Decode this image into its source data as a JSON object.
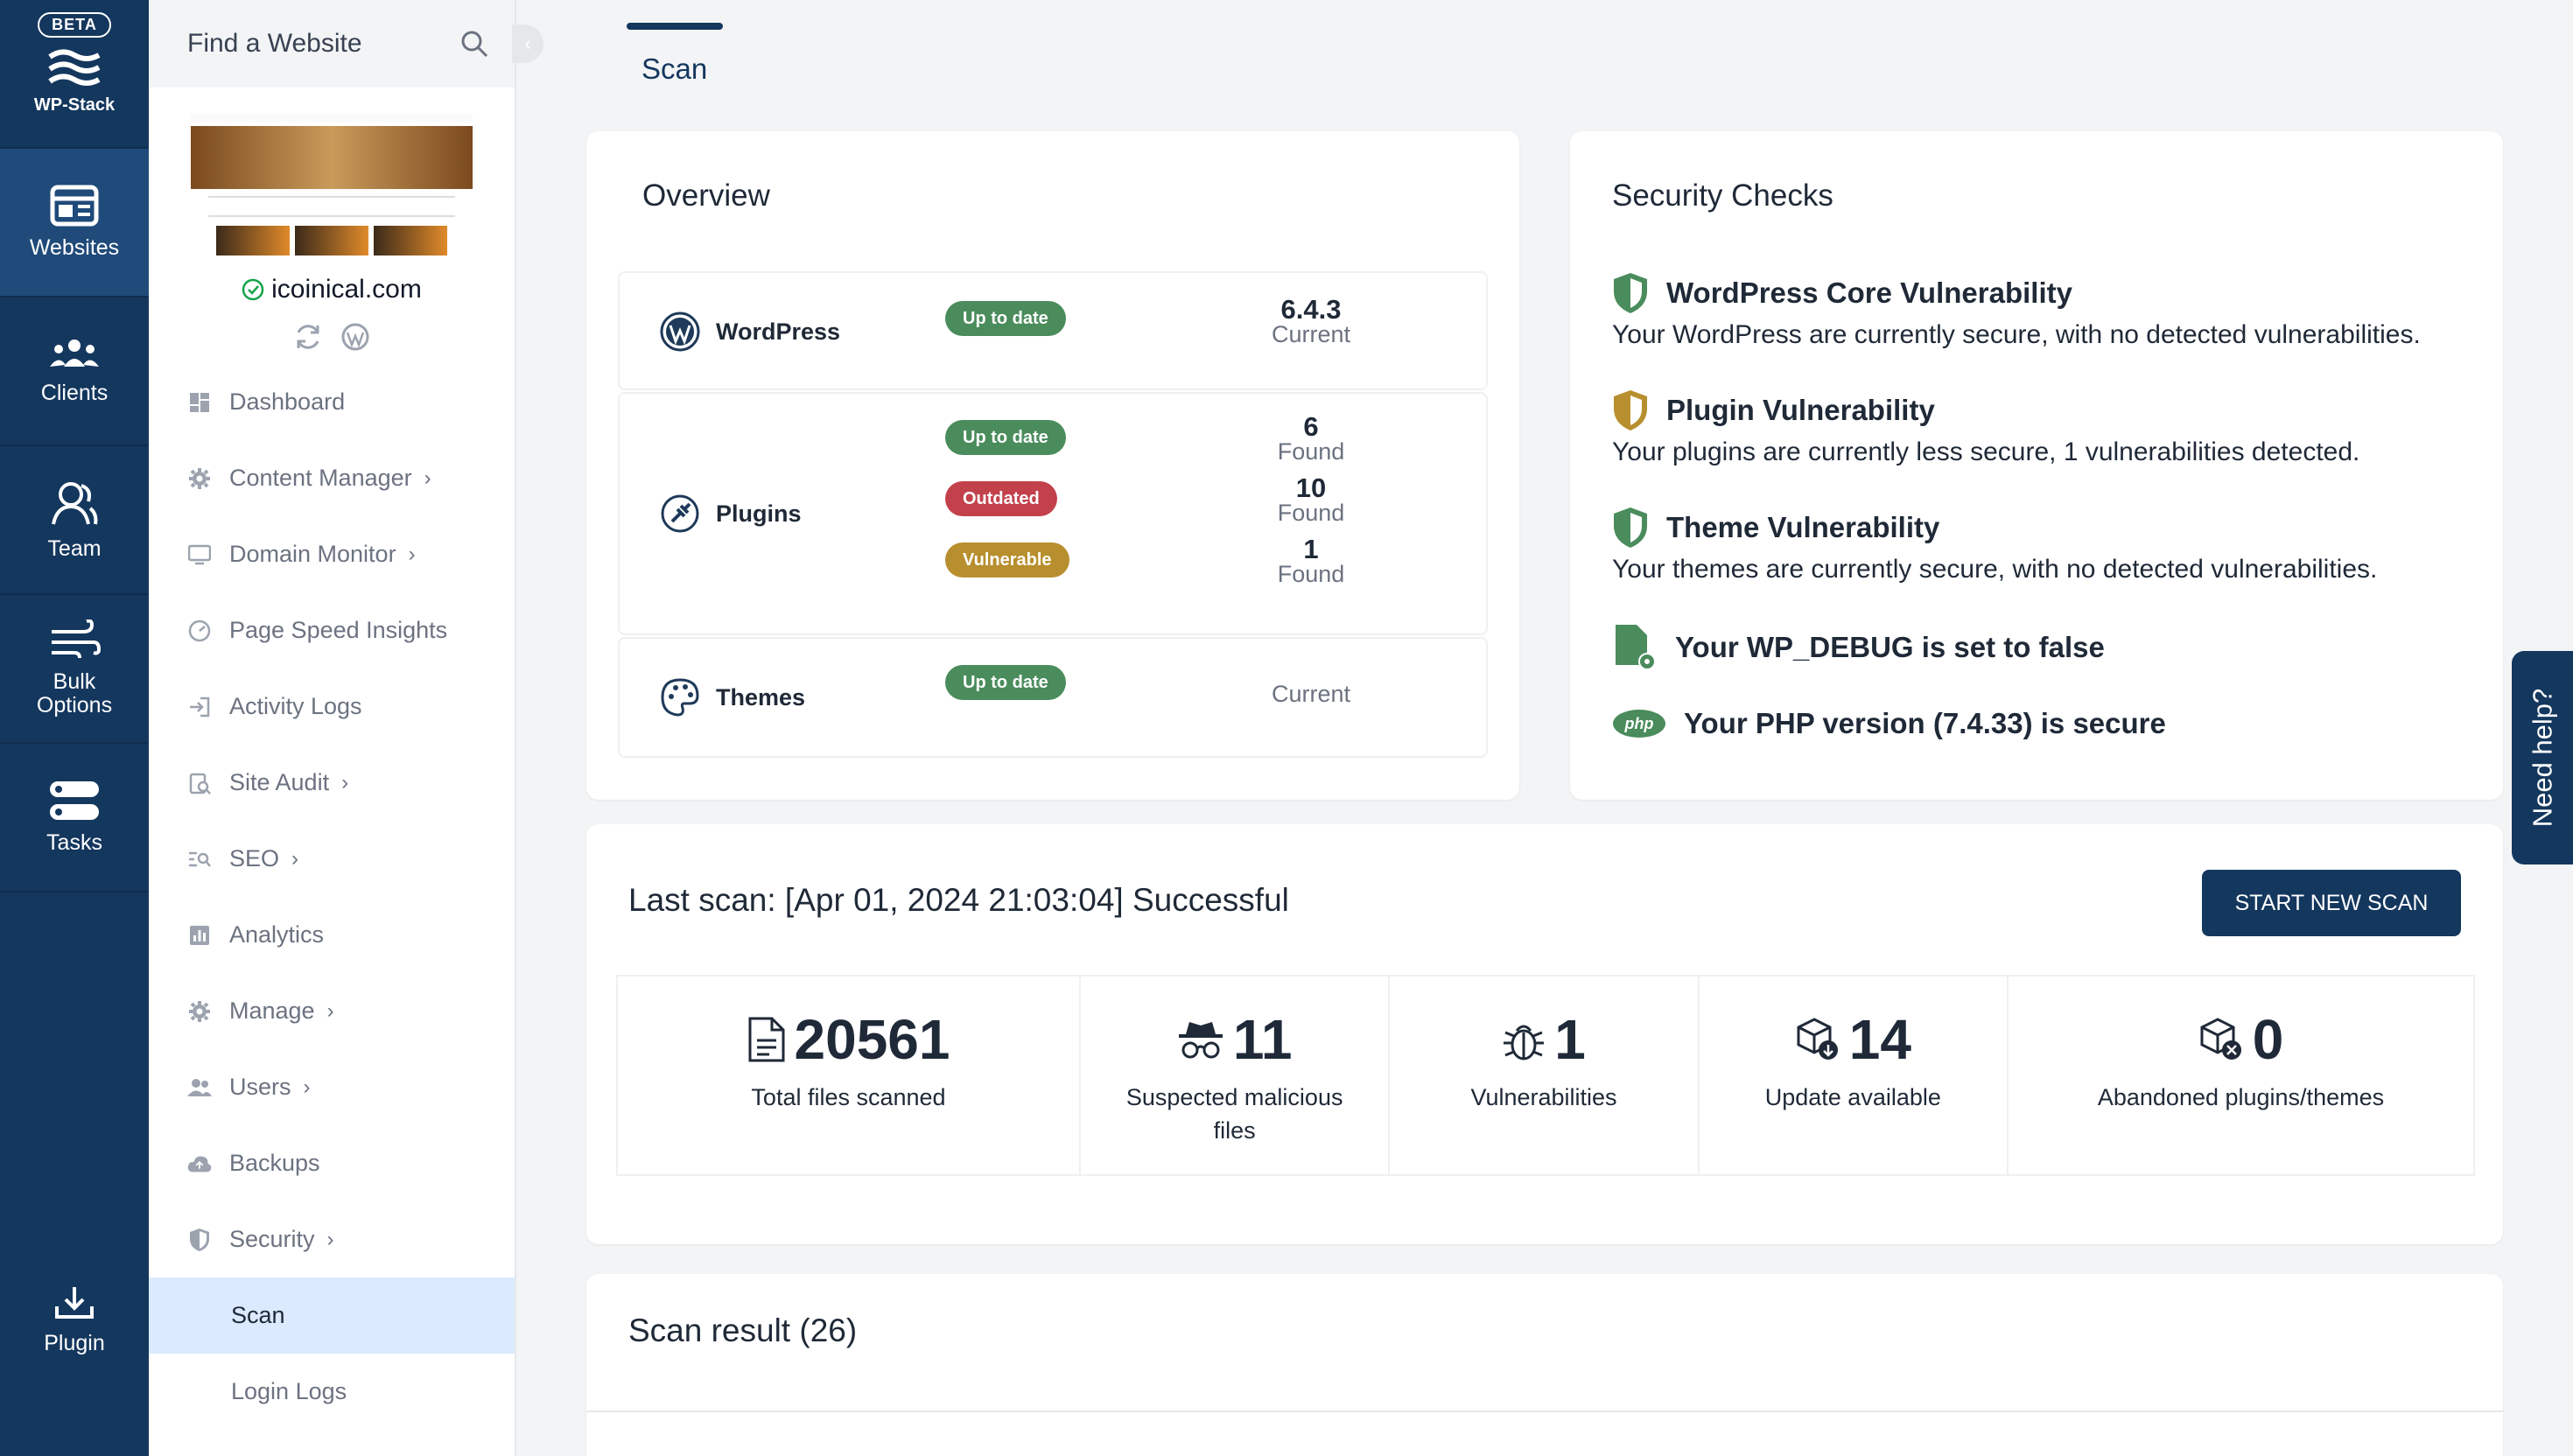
{
  "rail": {
    "beta": "BETA",
    "brand": "WP-Stack",
    "items": [
      {
        "label": "Websites",
        "icon": "websites-icon"
      },
      {
        "label": "Clients",
        "icon": "clients-icon"
      },
      {
        "label": "Team",
        "icon": "team-icon"
      },
      {
        "label": "Bulk Options",
        "icon": "wind-icon"
      },
      {
        "label": "Tasks",
        "icon": "tasks-icon"
      }
    ],
    "plugin": "Plugin"
  },
  "sidebar": {
    "search_placeholder": "Find a Website",
    "site_name": "icoinical.com",
    "menu": [
      {
        "label": "Dashboard",
        "icon": "dashboard-icon",
        "chevron": false
      },
      {
        "label": "Content Manager",
        "icon": "gear-icon",
        "chevron": true
      },
      {
        "label": "Domain Monitor",
        "icon": "monitor-icon",
        "chevron": true
      },
      {
        "label": "Page Speed Insights",
        "icon": "speedometer-icon",
        "chevron": false
      },
      {
        "label": "Activity Logs",
        "icon": "login-icon",
        "chevron": false
      },
      {
        "label": "Site Audit",
        "icon": "audit-icon",
        "chevron": true
      },
      {
        "label": "SEO",
        "icon": "seo-icon",
        "chevron": true
      },
      {
        "label": "Analytics",
        "icon": "analytics-icon",
        "chevron": false
      },
      {
        "label": "Manage",
        "icon": "gear-icon",
        "chevron": true
      },
      {
        "label": "Users",
        "icon": "users-icon",
        "chevron": true
      },
      {
        "label": "Backups",
        "icon": "cloud-icon",
        "chevron": false
      },
      {
        "label": "Security",
        "icon": "shield-icon",
        "chevron": true
      }
    ],
    "sub_active": "Scan",
    "sub_next": "Login Logs"
  },
  "tab": "Scan",
  "overview": {
    "title": "Overview",
    "wordpress": {
      "name": "WordPress",
      "badge": "Up to date",
      "value": "6.4.3",
      "label": "Current"
    },
    "plugins": {
      "name": "Plugins",
      "rows": [
        {
          "badge": "Up to date",
          "value": "6",
          "label": "Found"
        },
        {
          "badge": "Outdated",
          "value": "10",
          "label": "Found"
        },
        {
          "badge": "Vulnerable",
          "value": "1",
          "label": "Found"
        }
      ]
    },
    "themes": {
      "name": "Themes",
      "badge": "Up to date",
      "label": "Current"
    }
  },
  "security": {
    "title": "Security Checks",
    "items": [
      {
        "head": "WordPress Core Vulnerability",
        "desc": "Your WordPress are currently secure, with no detected vulnerabilities.",
        "color": "#4a8c5c"
      },
      {
        "head": "Plugin Vulnerability",
        "desc": "Your plugins are currently less secure, 1 vulnerabilities detected.",
        "color": "#b88f2e"
      },
      {
        "head": "Theme Vulnerability",
        "desc": "Your themes are currently secure, with no detected vulnerabilities.",
        "color": "#4a8c5c"
      }
    ],
    "debug": "Your WP_DEBUG is set to false",
    "php": "Your PHP version (7.4.33) is secure"
  },
  "last_scan": {
    "title": "Last scan: [Apr 01, 2024 21:03:04] Successful",
    "button": "START NEW SCAN",
    "stats": [
      {
        "value": "20561",
        "label": "Total files scanned",
        "icon": "file-icon"
      },
      {
        "value": "11",
        "label": "Suspected malicious files",
        "icon": "spy-icon"
      },
      {
        "value": "1",
        "label": "Vulnerabilities",
        "icon": "bug-icon"
      },
      {
        "value": "14",
        "label": "Update available",
        "icon": "package-update-icon"
      },
      {
        "value": "0",
        "label": "Abandoned plugins/themes",
        "icon": "package-abandoned-icon"
      }
    ]
  },
  "scan_result": {
    "title": "Scan result (26)"
  },
  "help": "Need help?"
}
